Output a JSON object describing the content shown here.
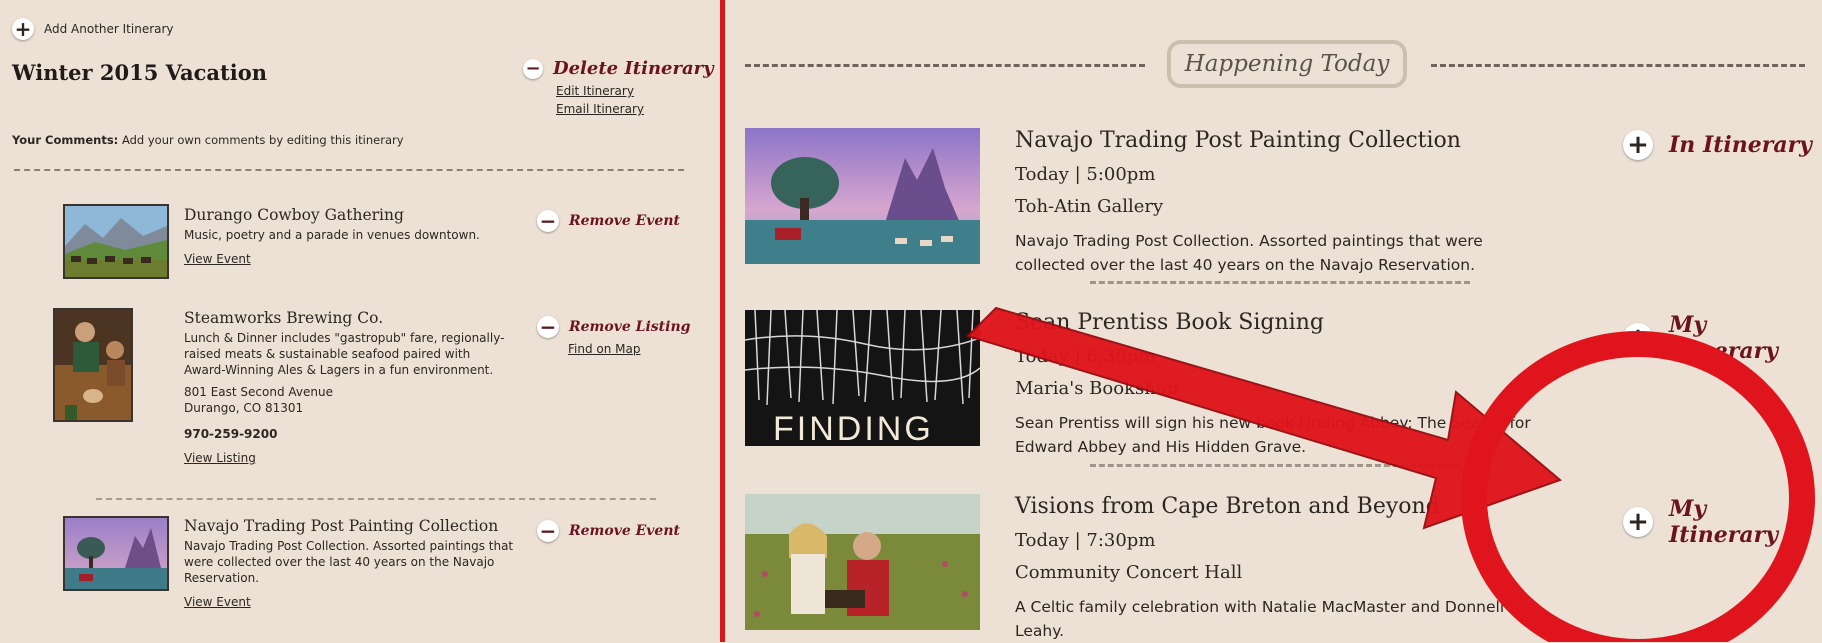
{
  "itinerary_panel": {
    "add_label": "Add Another Itinerary",
    "title": "Winter 2015 Vacation",
    "delete_label": "Delete Itinerary",
    "edit_label": "Edit Itinerary",
    "email_label": "Email Itinerary",
    "comments_label": "Your Comments:",
    "comments_text": "Add your own comments by editing this itinerary",
    "items": [
      {
        "title": "Durango Cowboy Gathering",
        "description": "Music, poetry and a parade in venues downtown.",
        "link": "View Event",
        "remove_label": "Remove Event"
      },
      {
        "title": "Steamworks Brewing Co.",
        "description": "Lunch & Dinner includes \"gastropub\" fare, regionally-raised meats & sustainable seafood paired with Award-Winning Ales & Lagers in a fun environment.",
        "address_line1": "801 East Second Avenue",
        "address_line2": "Durango, CO 81301",
        "phone": "970-259-9200",
        "link": "View Listing",
        "remove_label": "Remove Listing",
        "map_label": "Find on Map"
      },
      {
        "title": "Navajo Trading Post Painting Collection",
        "description": "Navajo Trading Post Collection. Assorted paintings that were collected over the last 40 years on the Navajo Reservation.",
        "link": "View Event",
        "remove_label": "Remove Event"
      }
    ]
  },
  "happening_today": {
    "heading": "Happening Today",
    "events": [
      {
        "title": "Navajo Trading Post Painting Collection",
        "time": "Today | 5:00pm",
        "venue": "Toh-Atin Gallery",
        "description": "Navajo Trading Post Collection. Assorted paintings that were collected over the last 40 years on the Navajo Reservation.",
        "action_label": "In Itinerary"
      },
      {
        "title": "Sean Prentiss Book Signing",
        "time": "Today | 6:30pm",
        "venue": "Maria's Bookshop",
        "description": "Sean Prentiss will sign his new book Finding Abbey: The Search for Edward Abbey and His Hidden Grave.",
        "image_caption": "FINDING",
        "action_label": "My Itinerary"
      },
      {
        "title": "Visions from Cape Breton and Beyond",
        "time": "Today | 7:30pm",
        "venue": "Community Concert Hall",
        "description": "A Celtic family celebration with Natalie MacMaster and Donnell Leahy.",
        "action_label": "My Itinerary"
      }
    ]
  },
  "colors": {
    "background": "#ece1d4",
    "divider": "#d7191e",
    "accent_text": "#6b1420",
    "annotation": "#e0141c"
  }
}
